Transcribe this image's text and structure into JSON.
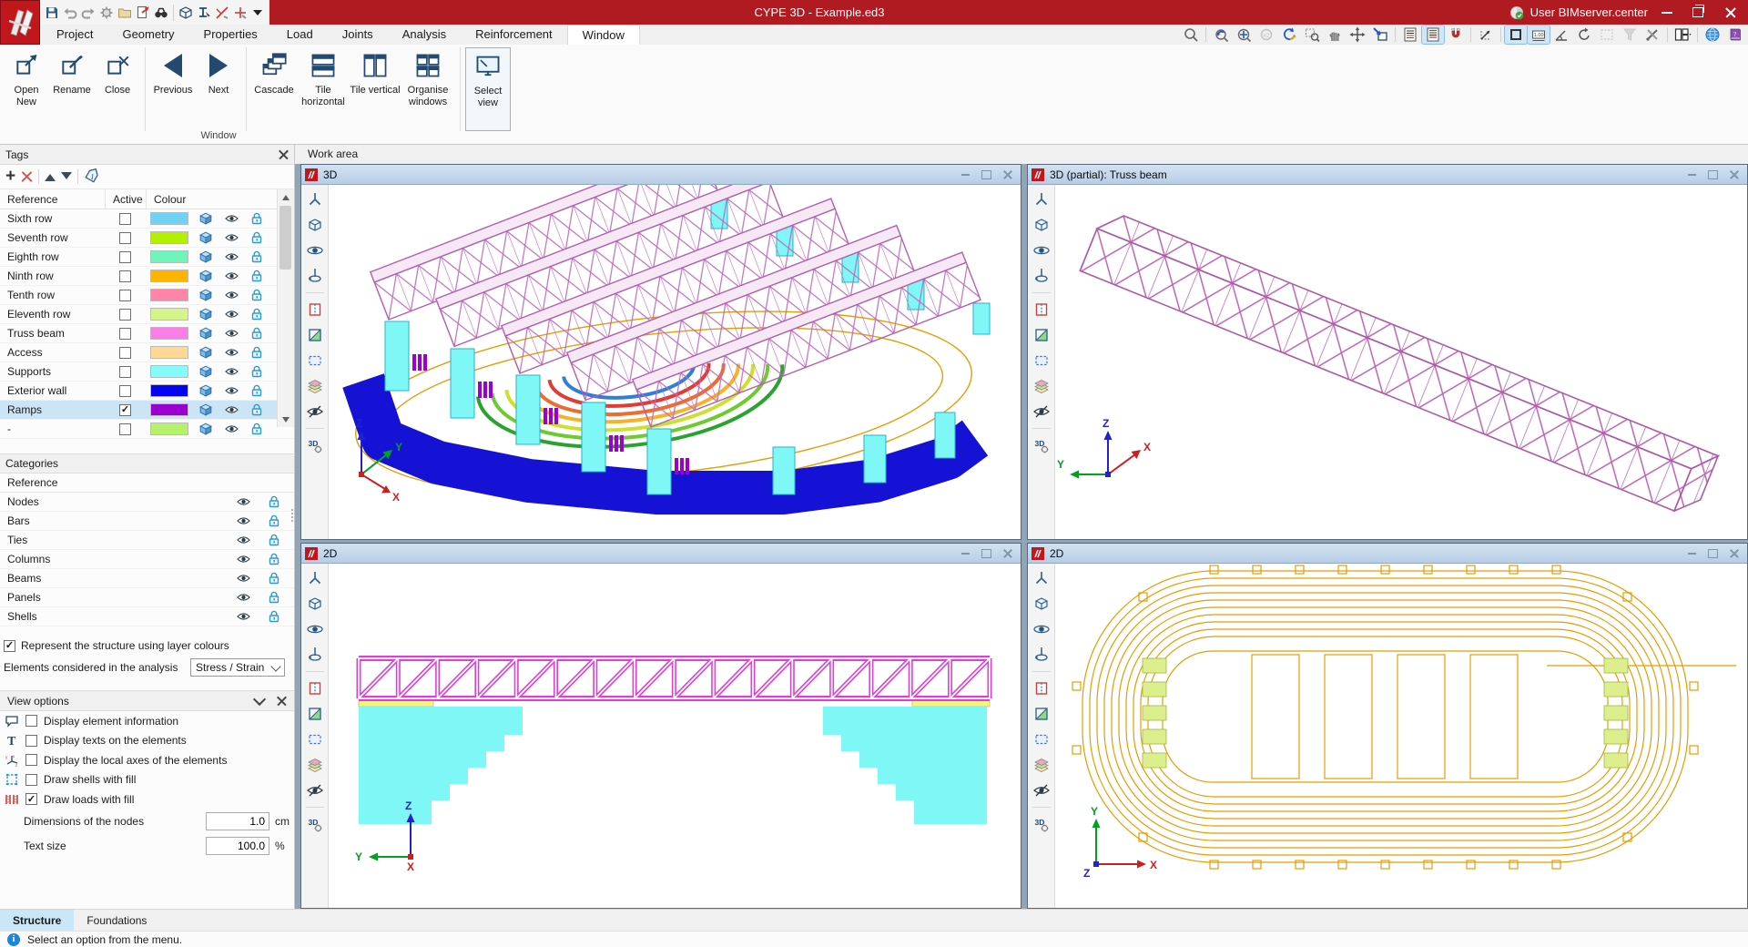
{
  "app": {
    "title": "CYPE 3D - Example.ed3",
    "user": "User BIMserver.center"
  },
  "menubar": {
    "items": [
      {
        "label": "Project"
      },
      {
        "label": "Geometry"
      },
      {
        "label": "Properties"
      },
      {
        "label": "Load"
      },
      {
        "label": "Joints"
      },
      {
        "label": "Analysis"
      },
      {
        "label": "Reinforcement"
      },
      {
        "label": "Window",
        "active": true
      }
    ]
  },
  "ribbon": {
    "group_label": "Window",
    "buttons": [
      {
        "label": "Open New"
      },
      {
        "label": "Rename"
      },
      {
        "label": "Close"
      },
      {
        "label": "Previous"
      },
      {
        "label": "Next"
      },
      {
        "label": "Cascade"
      },
      {
        "label": "Tile horizontal"
      },
      {
        "label": "Tile vertical"
      },
      {
        "label": "Organise windows"
      },
      {
        "label": "Select view"
      }
    ]
  },
  "tags_panel": {
    "title": "Tags",
    "columns": {
      "reference": "Reference",
      "active": "Active",
      "colour": "Colour"
    },
    "rows": [
      {
        "name": "Sixth row",
        "active": false,
        "selected": false,
        "color": "#6FD2F5"
      },
      {
        "name": "Seventh row",
        "active": false,
        "selected": false,
        "color": "#B2F000"
      },
      {
        "name": "Eighth row",
        "active": false,
        "selected": false,
        "color": "#6FF5BC"
      },
      {
        "name": "Ninth row",
        "active": false,
        "selected": false,
        "color": "#FFB400"
      },
      {
        "name": "Tenth row",
        "active": false,
        "selected": false,
        "color": "#FF85A8"
      },
      {
        "name": "Eleventh row",
        "active": false,
        "selected": false,
        "color": "#D5F58A"
      },
      {
        "name": "Truss beam",
        "active": false,
        "selected": false,
        "color": "#FB7DE8"
      },
      {
        "name": "Access",
        "active": false,
        "selected": false,
        "color": "#FFD895"
      },
      {
        "name": "Supports",
        "active": false,
        "selected": false,
        "color": "#84FBFB"
      },
      {
        "name": "Exterior wall",
        "active": false,
        "selected": false,
        "color": "#0502F2"
      },
      {
        "name": "Ramps",
        "active": true,
        "selected": true,
        "color": "#9B00D0"
      },
      {
        "name": "-",
        "active": false,
        "selected": false,
        "color": "#B5F26A"
      }
    ]
  },
  "categories_panel": {
    "title": "Categories",
    "header": "Reference",
    "items": [
      {
        "name": "Nodes"
      },
      {
        "name": "Bars"
      },
      {
        "name": "Ties"
      },
      {
        "name": "Columns"
      },
      {
        "name": "Beams"
      },
      {
        "name": "Panels"
      },
      {
        "name": "Shells"
      }
    ]
  },
  "display_options": {
    "layer_colours_label": "Represent the structure using layer colours",
    "layer_colours_checked": true,
    "elements_label": "Elements considered in the analysis",
    "elements_value": "Stress / Strain"
  },
  "view_options": {
    "title": "View options",
    "items": [
      {
        "label": "Display element information",
        "checked": false
      },
      {
        "label": "Display texts on the elements",
        "checked": false
      },
      {
        "label": "Display the local axes of the elements",
        "checked": false
      },
      {
        "label": "Draw shells with fill",
        "checked": false
      },
      {
        "label": "Draw loads with fill",
        "checked": true
      }
    ],
    "fields": [
      {
        "label": "Dimensions of the nodes",
        "value": "1.0",
        "unit": "cm"
      },
      {
        "label": "Text size",
        "value": "100.0",
        "unit": "%"
      }
    ]
  },
  "bottom_tabs": {
    "items": [
      {
        "label": "Structure",
        "active": true
      },
      {
        "label": "Foundations",
        "active": false
      }
    ]
  },
  "status_bar": {
    "message": "Select an option from the menu."
  },
  "work_area": {
    "label": "Work area",
    "windows": [
      {
        "title": "3D",
        "axes": {
          "x": "X",
          "y": "Y",
          "z": "Z"
        }
      },
      {
        "title": "3D (partial): Truss beam",
        "axes": {
          "x": "X",
          "y": "Y",
          "z": "Z"
        }
      },
      {
        "title": "2D",
        "axes": {
          "x": "X",
          "y": "Y",
          "z": "Z"
        }
      },
      {
        "title": "2D",
        "axes": {
          "x": "X",
          "y": "Y",
          "z": "Z"
        }
      }
    ]
  },
  "icons": {
    "quick_access": [
      "save",
      "undo",
      "redo",
      "configuration",
      "open",
      "export",
      "find",
      "view-3d",
      "element-info",
      "dimension-red",
      "axes-red",
      "more-dropdown"
    ],
    "view_toolbar": [
      "search",
      "zoom-previous",
      "zoom-extents",
      "zoom-x2",
      "redraw",
      "zoom-window",
      "pan",
      "move",
      "send-to-view",
      "dxf-import",
      "dxf-layers",
      "snap-magnet",
      "coordinate-axes",
      "line-thickness",
      "dimension-display",
      "angle",
      "arc-rotation",
      "selection-box",
      "filter",
      "tools",
      "window-layout",
      "bimserver-globe",
      "help-book"
    ],
    "viewport_toolbar": [
      "node-axes",
      "view-3d-cube",
      "orbit",
      "rotate-pivot",
      "shell-edit",
      "plane-view",
      "section-box",
      "layers",
      "hide-elements",
      "view-3d-settings"
    ]
  },
  "colors": {
    "titlebar": "#B01B22",
    "selection": "#CBE4F6",
    "mdi_titlebar": "#C3D6EA",
    "plan_orange": "#E89C00",
    "truss_3d": "#C468BE",
    "truss_2d": "#E03ED8",
    "support_cyan": "#7FF7F7",
    "wall_blue": "#1512D6",
    "ramp_purple": "#9B00D0"
  }
}
